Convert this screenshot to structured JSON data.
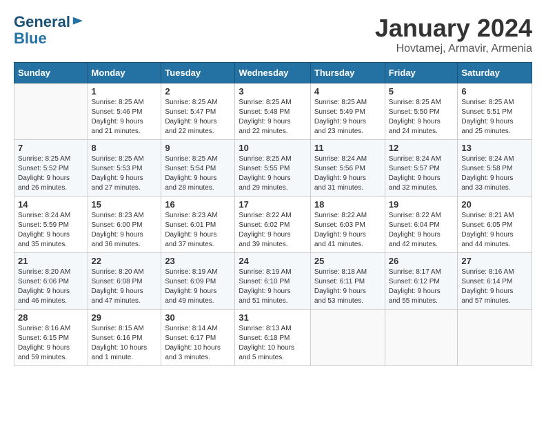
{
  "header": {
    "logo_line1": "General",
    "logo_line2": "Blue",
    "month": "January 2024",
    "location": "Hovtamej, Armavir, Armenia"
  },
  "weekdays": [
    "Sunday",
    "Monday",
    "Tuesday",
    "Wednesday",
    "Thursday",
    "Friday",
    "Saturday"
  ],
  "weeks": [
    [
      {
        "day": "",
        "info": ""
      },
      {
        "day": "1",
        "info": "Sunrise: 8:25 AM\nSunset: 5:46 PM\nDaylight: 9 hours\nand 21 minutes."
      },
      {
        "day": "2",
        "info": "Sunrise: 8:25 AM\nSunset: 5:47 PM\nDaylight: 9 hours\nand 22 minutes."
      },
      {
        "day": "3",
        "info": "Sunrise: 8:25 AM\nSunset: 5:48 PM\nDaylight: 9 hours\nand 22 minutes."
      },
      {
        "day": "4",
        "info": "Sunrise: 8:25 AM\nSunset: 5:49 PM\nDaylight: 9 hours\nand 23 minutes."
      },
      {
        "day": "5",
        "info": "Sunrise: 8:25 AM\nSunset: 5:50 PM\nDaylight: 9 hours\nand 24 minutes."
      },
      {
        "day": "6",
        "info": "Sunrise: 8:25 AM\nSunset: 5:51 PM\nDaylight: 9 hours\nand 25 minutes."
      }
    ],
    [
      {
        "day": "7",
        "info": "Sunrise: 8:25 AM\nSunset: 5:52 PM\nDaylight: 9 hours\nand 26 minutes."
      },
      {
        "day": "8",
        "info": "Sunrise: 8:25 AM\nSunset: 5:53 PM\nDaylight: 9 hours\nand 27 minutes."
      },
      {
        "day": "9",
        "info": "Sunrise: 8:25 AM\nSunset: 5:54 PM\nDaylight: 9 hours\nand 28 minutes."
      },
      {
        "day": "10",
        "info": "Sunrise: 8:25 AM\nSunset: 5:55 PM\nDaylight: 9 hours\nand 29 minutes."
      },
      {
        "day": "11",
        "info": "Sunrise: 8:24 AM\nSunset: 5:56 PM\nDaylight: 9 hours\nand 31 minutes."
      },
      {
        "day": "12",
        "info": "Sunrise: 8:24 AM\nSunset: 5:57 PM\nDaylight: 9 hours\nand 32 minutes."
      },
      {
        "day": "13",
        "info": "Sunrise: 8:24 AM\nSunset: 5:58 PM\nDaylight: 9 hours\nand 33 minutes."
      }
    ],
    [
      {
        "day": "14",
        "info": "Sunrise: 8:24 AM\nSunset: 5:59 PM\nDaylight: 9 hours\nand 35 minutes."
      },
      {
        "day": "15",
        "info": "Sunrise: 8:23 AM\nSunset: 6:00 PM\nDaylight: 9 hours\nand 36 minutes."
      },
      {
        "day": "16",
        "info": "Sunrise: 8:23 AM\nSunset: 6:01 PM\nDaylight: 9 hours\nand 37 minutes."
      },
      {
        "day": "17",
        "info": "Sunrise: 8:22 AM\nSunset: 6:02 PM\nDaylight: 9 hours\nand 39 minutes."
      },
      {
        "day": "18",
        "info": "Sunrise: 8:22 AM\nSunset: 6:03 PM\nDaylight: 9 hours\nand 41 minutes."
      },
      {
        "day": "19",
        "info": "Sunrise: 8:22 AM\nSunset: 6:04 PM\nDaylight: 9 hours\nand 42 minutes."
      },
      {
        "day": "20",
        "info": "Sunrise: 8:21 AM\nSunset: 6:05 PM\nDaylight: 9 hours\nand 44 minutes."
      }
    ],
    [
      {
        "day": "21",
        "info": "Sunrise: 8:20 AM\nSunset: 6:06 PM\nDaylight: 9 hours\nand 46 minutes."
      },
      {
        "day": "22",
        "info": "Sunrise: 8:20 AM\nSunset: 6:08 PM\nDaylight: 9 hours\nand 47 minutes."
      },
      {
        "day": "23",
        "info": "Sunrise: 8:19 AM\nSunset: 6:09 PM\nDaylight: 9 hours\nand 49 minutes."
      },
      {
        "day": "24",
        "info": "Sunrise: 8:19 AM\nSunset: 6:10 PM\nDaylight: 9 hours\nand 51 minutes."
      },
      {
        "day": "25",
        "info": "Sunrise: 8:18 AM\nSunset: 6:11 PM\nDaylight: 9 hours\nand 53 minutes."
      },
      {
        "day": "26",
        "info": "Sunrise: 8:17 AM\nSunset: 6:12 PM\nDaylight: 9 hours\nand 55 minutes."
      },
      {
        "day": "27",
        "info": "Sunrise: 8:16 AM\nSunset: 6:14 PM\nDaylight: 9 hours\nand 57 minutes."
      }
    ],
    [
      {
        "day": "28",
        "info": "Sunrise: 8:16 AM\nSunset: 6:15 PM\nDaylight: 9 hours\nand 59 minutes."
      },
      {
        "day": "29",
        "info": "Sunrise: 8:15 AM\nSunset: 6:16 PM\nDaylight: 10 hours\nand 1 minute."
      },
      {
        "day": "30",
        "info": "Sunrise: 8:14 AM\nSunset: 6:17 PM\nDaylight: 10 hours\nand 3 minutes."
      },
      {
        "day": "31",
        "info": "Sunrise: 8:13 AM\nSunset: 6:18 PM\nDaylight: 10 hours\nand 5 minutes."
      },
      {
        "day": "",
        "info": ""
      },
      {
        "day": "",
        "info": ""
      },
      {
        "day": "",
        "info": ""
      }
    ]
  ]
}
